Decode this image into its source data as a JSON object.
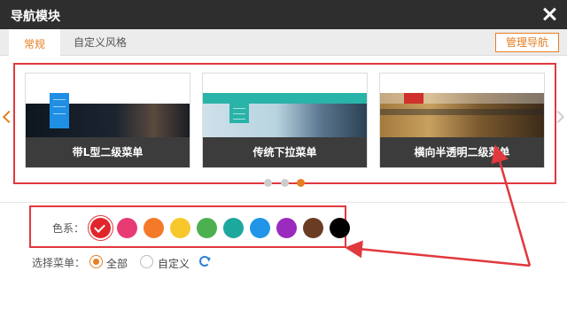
{
  "window": {
    "title": "导航模块"
  },
  "tabs": [
    {
      "label": "常规",
      "active": true
    },
    {
      "label": "自定义风格",
      "active": false
    }
  ],
  "toolbar": {
    "manage_label": "管理导航"
  },
  "carousel": {
    "cards": [
      {
        "caption": "带L型二级菜单"
      },
      {
        "caption": "传统下拉菜单"
      },
      {
        "caption": "横向半透明二级菜单"
      }
    ],
    "active_page": 3,
    "page_count": 3
  },
  "colors": {
    "label": "色系：",
    "swatches": [
      "#e0262b",
      "#e83a73",
      "#f47a2a",
      "#f6c82c",
      "#4cb050",
      "#1da89e",
      "#2196e8",
      "#9b2bbf",
      "#6a3c24",
      "#000000"
    ],
    "selected_index": 0,
    "accent": "#e67e22",
    "annotation_red": "#e0393e"
  },
  "menu_select": {
    "label": "选择菜单：",
    "options": [
      {
        "label": "全部",
        "checked": true
      },
      {
        "label": "自定义",
        "checked": false
      }
    ],
    "refresh_icon": "refresh-icon"
  }
}
